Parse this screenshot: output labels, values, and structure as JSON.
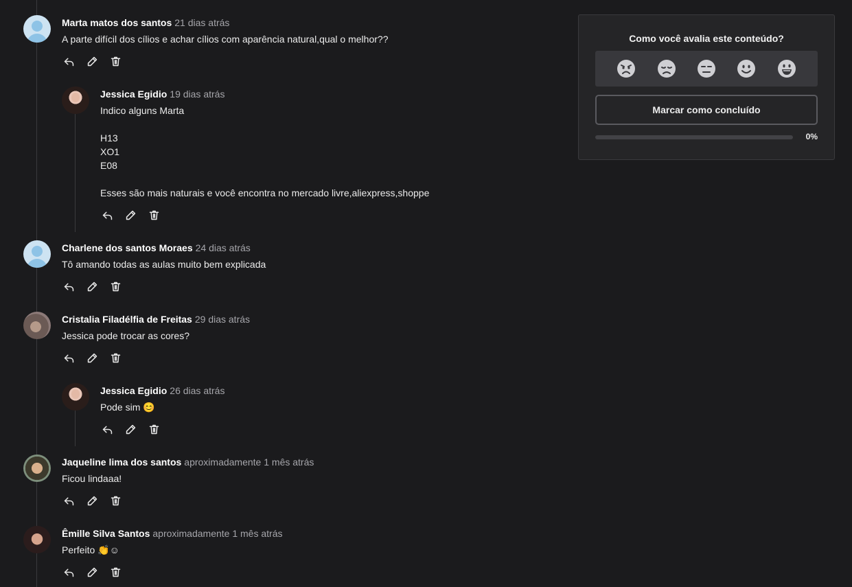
{
  "comments": [
    {
      "author": "Marta matos dos santos",
      "time": "21 dias atrás",
      "text": [
        "A parte difícil dos cílios e achar cílios com aparência natural,qual o melhor??"
      ],
      "reply": {
        "author": "Jessica Egidio",
        "time": "19 dias atrás",
        "text": [
          "Indico alguns Marta",
          "",
          "H13",
          "XO1",
          "E08",
          "",
          "Esses são mais naturais e você encontra no mercado livre,aliexpress,shoppe"
        ]
      }
    },
    {
      "author": "Charlene dos santos Moraes",
      "time": "24 dias atrás",
      "text": [
        "Tô amando todas as aulas muito bem explicada"
      ]
    },
    {
      "author": "Cristalia Filadélfia de Freitas",
      "time": "29 dias atrás",
      "text": [
        "Jessica pode trocar as cores?"
      ],
      "reply": {
        "author": "Jessica Egidio",
        "time": "26 dias atrás",
        "text": [
          "Pode sim 😊"
        ]
      }
    },
    {
      "author": "Jaqueline lima dos santos",
      "time": "aproximadamente 1 mês atrás",
      "text": [
        "Ficou lindaaa!"
      ]
    },
    {
      "author": "Êmille Silva Santos",
      "time": "aproximadamente 1 mês atrás",
      "text": [
        "Perfeito 👏☺"
      ]
    }
  ],
  "actions": {
    "reply_icon": "reply-icon",
    "edit_icon": "pencil-icon",
    "delete_icon": "trash-icon"
  },
  "rating_panel": {
    "title": "Como você avalia este conteúdo?",
    "emojis": [
      "angry-face-icon",
      "sad-face-icon",
      "neutral-face-icon",
      "smile-face-icon",
      "grin-face-icon"
    ],
    "done_button": "Marcar como concluído",
    "progress_label": "0%",
    "progress_value": 0
  },
  "colors": {
    "background": "#1b1b1d",
    "panel": "#252527",
    "emoji_bar": "#38383c",
    "muted_text": "#a6a6ab"
  }
}
